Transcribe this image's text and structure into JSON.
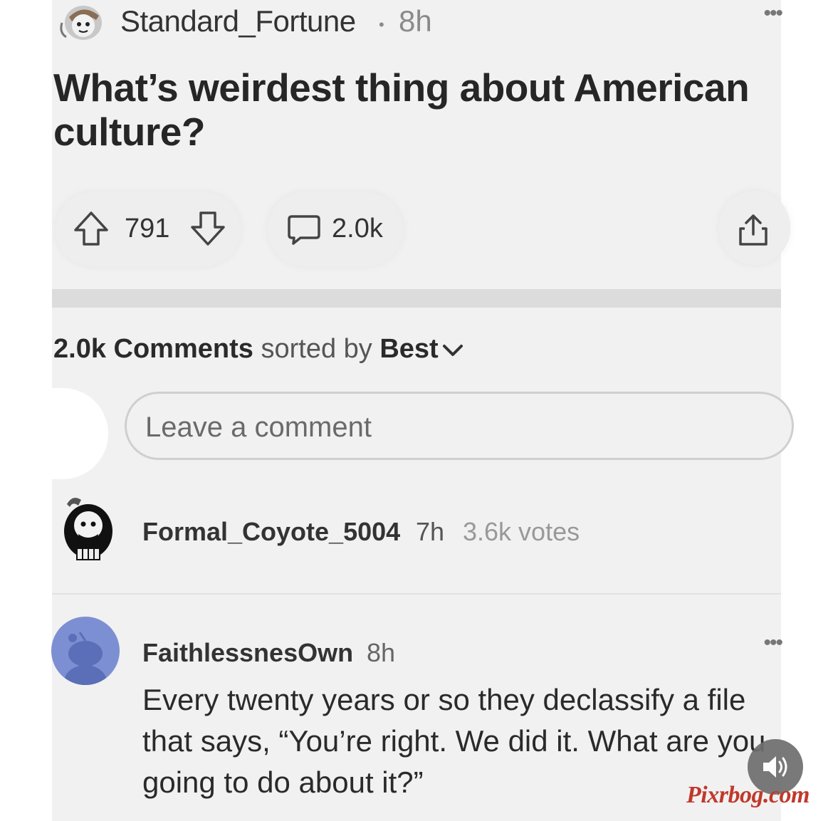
{
  "post": {
    "author": "Standard_Fortune",
    "separator": "•",
    "time": "8h",
    "more": "•••",
    "title": "What’s weirdest thing about American culture?",
    "votes": "791",
    "comments": "2.0k"
  },
  "comments_section": {
    "count": "2.0k",
    "comments_word": "Comments",
    "sorted_by": "sorted by",
    "sort_value": "Best",
    "input_placeholder": "Leave a comment"
  },
  "comments": [
    {
      "author": "Formal_Coyote_5004",
      "time": "7h",
      "votes": "3.6k votes"
    },
    {
      "author": "FaithlessnesOwn",
      "time": "8h",
      "more": "•••",
      "body": "Every twenty years or so they declassify a file that says, “You’re right. We did it. What are you going to do about it?”"
    }
  ],
  "watermark": "Pixrbog.com",
  "colors": {
    "avatar_blue": "#7d8fd3",
    "watermark_red": "#c0392b"
  }
}
